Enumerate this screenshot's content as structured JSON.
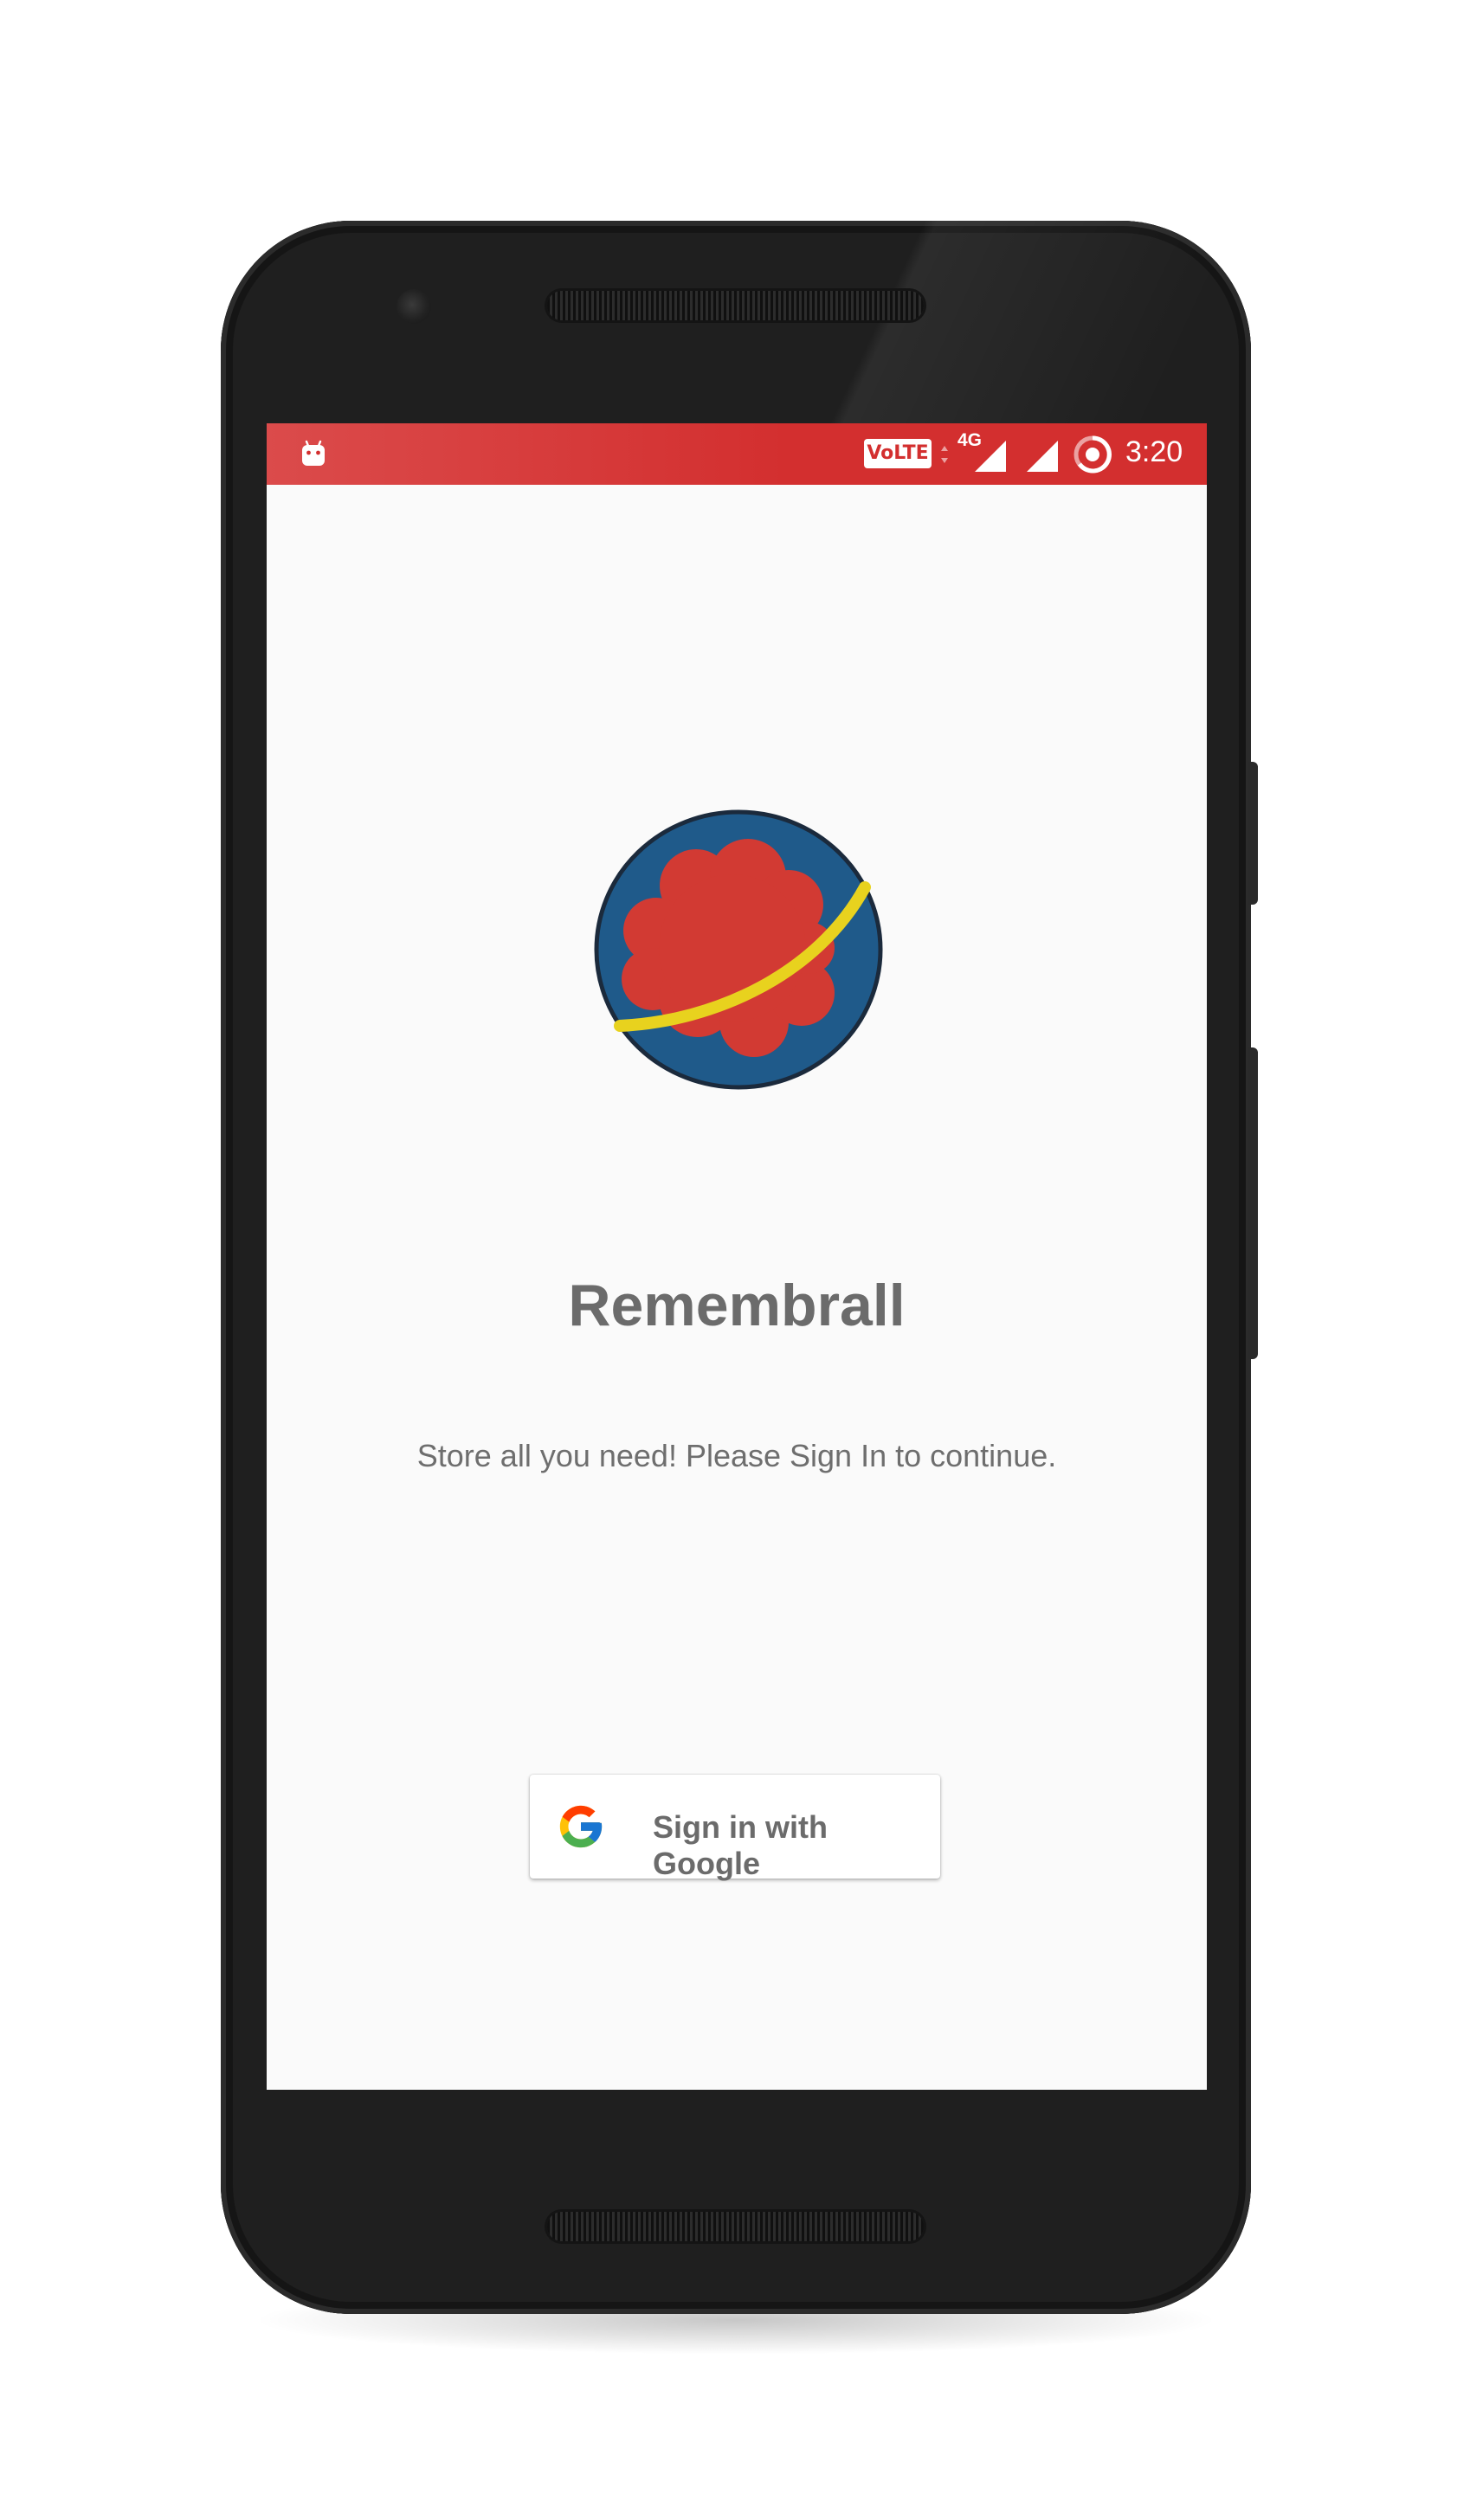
{
  "status_bar": {
    "volte_label": "VoLTE",
    "network_label": "4G",
    "time": "3:20",
    "color": "#d32f2f",
    "icons": [
      "android-debug-icon",
      "volte-icon",
      "data-arrows-icon",
      "signal-4g-icon",
      "signal-icon",
      "battery-saver-icon"
    ]
  },
  "app": {
    "title": "Remembrall",
    "subtitle": "Store all you need! Please Sign In to continue.",
    "logo_icon": "remembrall-logo-icon",
    "logo_colors": {
      "ball": "#1f5a8a",
      "cloud": "#d23a33",
      "ring": "#e8d21e"
    }
  },
  "sign_in": {
    "label": "Sign in with Google",
    "icon": "google-g-icon"
  }
}
